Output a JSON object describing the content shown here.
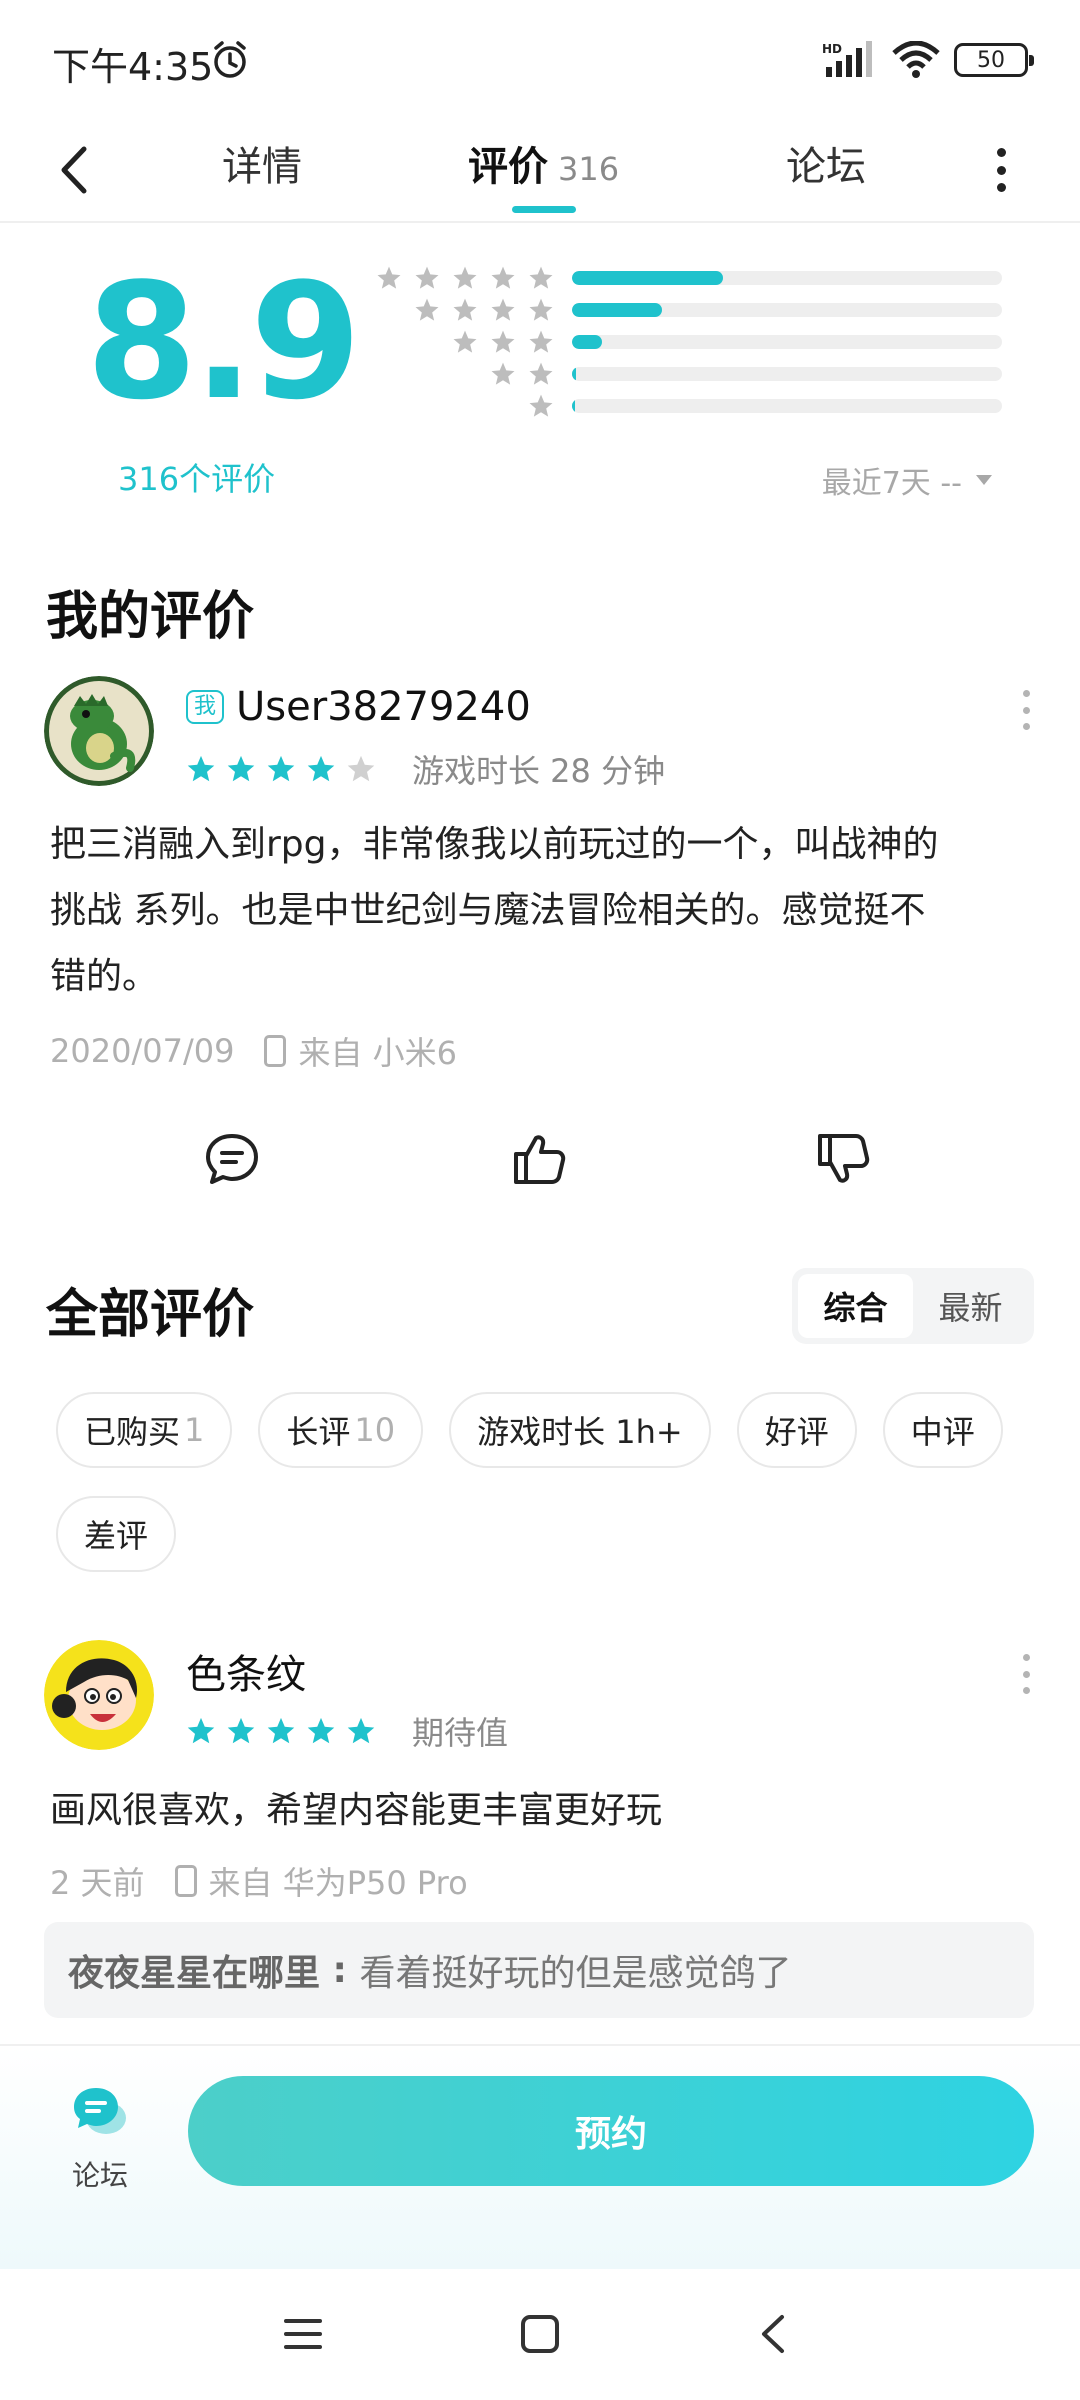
{
  "status": {
    "time": "下午4:35",
    "network": "HD",
    "battery": "50"
  },
  "nav": {
    "tabs": [
      {
        "label": "详情"
      },
      {
        "label": "评价",
        "count": "316"
      },
      {
        "label": "论坛"
      }
    ]
  },
  "rating": {
    "score": "8.9",
    "count_label": "316个评价",
    "distribution": [
      {
        "stars": 5,
        "fraction": 0.35
      },
      {
        "stars": 4,
        "fraction": 0.21
      },
      {
        "stars": 3,
        "fraction": 0.07
      },
      {
        "stars": 2,
        "fraction": 0.01
      },
      {
        "stars": 1,
        "fraction": 0.005
      }
    ],
    "range_label": "最近7天 --"
  },
  "my_review": {
    "title": "我的评价",
    "badge": "我",
    "user": "User38279240",
    "stars": 4,
    "meta": "游戏时长 28 分钟",
    "text_lines": [
      "把三消融入到rpg，非常像我以前玩过的一个，叫战神的",
      "挑战 系列。也是中世纪剑与魔法冒险相关的。感觉挺不",
      "错的。"
    ],
    "date": "2020/07/09",
    "device": "来自 小米6"
  },
  "all_reviews": {
    "title": "全部评价",
    "sort_options": [
      "综合",
      "最新"
    ],
    "filters": [
      {
        "label": "已购买",
        "count": "1"
      },
      {
        "label": "长评",
        "count": "10"
      },
      {
        "label": "游戏时长 1h+",
        "count": ""
      },
      {
        "label": "好评",
        "count": ""
      },
      {
        "label": "中评",
        "count": ""
      },
      {
        "label": "差评",
        "count": ""
      }
    ],
    "first_review": {
      "user": "色条纹",
      "stars": 5,
      "meta": "期待值",
      "text": "画风很喜欢，希望内容能更丰富更好玩",
      "date": "2 天前",
      "device": "来自 华为P50 Pro",
      "reply_name": "夜夜星星在哪里",
      "reply_text": "看着挺好玩的但是感觉鸽了"
    }
  },
  "bottom": {
    "forum_label": "论坛",
    "reserve_label": "预约"
  },
  "colors": {
    "accent": "#1fc2cc",
    "star_empty": "#d0d0d0",
    "star_gray": "#bdbdbd"
  }
}
